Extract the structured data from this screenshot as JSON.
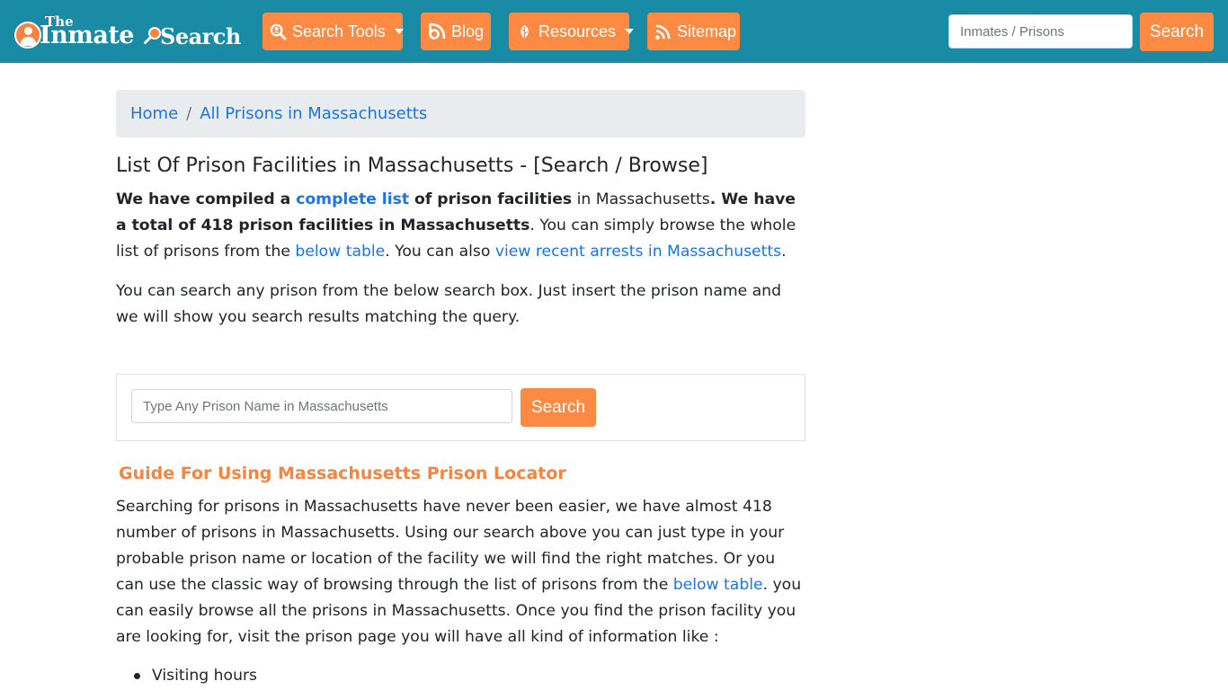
{
  "logo": {
    "the": "The",
    "inmate": "Inmate",
    "search": "Search"
  },
  "nav": {
    "items": [
      {
        "label": "Search Tools",
        "icon": "search-user-icon",
        "dropdown": true
      },
      {
        "label": "Blog",
        "icon": "blog-icon",
        "dropdown": false
      },
      {
        "label": "Resources",
        "icon": "leaf-icon",
        "dropdown": true
      },
      {
        "label": "Sitemap",
        "icon": "rss-icon",
        "dropdown": false
      }
    ],
    "search_placeholder": "Inmates / Prisons",
    "search_button": "Search"
  },
  "breadcrumb": {
    "home": "Home",
    "separator": "/",
    "current": "All Prisons in Massachusetts"
  },
  "main": {
    "title": "List Of Prison Facilities in Massachusetts - [Search / Browse]",
    "lead": {
      "p1": "We have compiled a ",
      "link1": "complete list",
      "p2": " of prison facilities",
      "p3": " in Massachusetts",
      "p4": ". We have a total of 418 prison facilities in Massachusetts",
      "p5": ". You can simply browse the whole list of prisons from the ",
      "link2": "below table",
      "p6": ". You can also ",
      "link3": "view recent arrests in Massachusetts",
      "p7": "."
    },
    "para": "You can search any prison from the below search box. Just insert the prison name and we will show you search results matching the query."
  },
  "search_box": {
    "placeholder": "Type Any Prison Name in Massachusetts",
    "button": "Search"
  },
  "guide": {
    "title": "Guide For Using Massachusetts Prison Locator",
    "text1": "Searching for prisons in Massachusetts have never been easier, we have almost 418 number of prisons in Massachusetts. Using our search above you can just type in your probable prison name or location of the facility we will find the right matches. Or you can use the classic way of browsing through the list of prisons from the ",
    "link": "below table",
    "text2": ". you can easily browse all the prisons in Massachusetts. Once you find the prison facility you are looking for, visit the prison page you will have all kind of information like :",
    "list": [
      "Visiting hours"
    ]
  },
  "colors": {
    "navbar": "#1a8ba4",
    "accent": "#fc8a42",
    "link": "#1a73e8",
    "guide_title": "#f58440"
  }
}
